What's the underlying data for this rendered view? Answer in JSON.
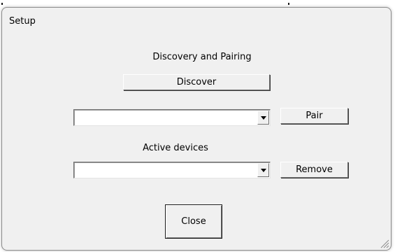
{
  "window": {
    "title": "Setup"
  },
  "discovery": {
    "heading": "Discovery and Pairing",
    "discover_label": "Discover",
    "found_devices_value": "",
    "pair_label": "Pair"
  },
  "active": {
    "heading": "Active devices",
    "devices_value": "",
    "remove_label": "Remove"
  },
  "footer": {
    "close_label": "Close"
  },
  "icons": {
    "dropdown_arrow": "chevron-down-icon",
    "resize_grip": "resize-grip-icon"
  },
  "colors": {
    "window_bg": "#f0f0f0",
    "field_bg": "#ffffff",
    "text": "#000000"
  }
}
